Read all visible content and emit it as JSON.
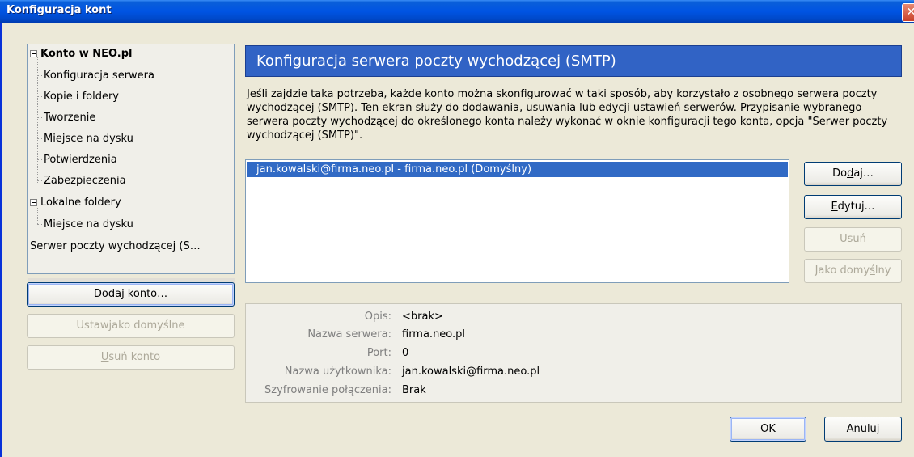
{
  "window": {
    "title": "Konfiguracja kont",
    "close_glyph": "✕"
  },
  "tree": {
    "items": [
      {
        "label": "Konto w NEO.pl",
        "bold": true
      },
      {
        "label": "Konfiguracja serwera"
      },
      {
        "label": "Kopie i foldery"
      },
      {
        "label": "Tworzenie"
      },
      {
        "label": "Miejsce na dysku"
      },
      {
        "label": "Potwierdzenia"
      },
      {
        "label": "Zabezpieczenia"
      },
      {
        "label": "Lokalne foldery"
      },
      {
        "label": "Miejsce na dysku"
      },
      {
        "label": "Serwer poczty wychodzącej (S…"
      }
    ]
  },
  "left_buttons": {
    "add_account": {
      "pre": "",
      "key": "D",
      "post": "odaj konto…"
    },
    "set_default": {
      "pre": "Ustaw ",
      "key": "j",
      "post": "ako domyślne"
    },
    "remove_account": {
      "pre": "",
      "key": "U",
      "post": "suń konto"
    }
  },
  "header": {
    "title": "Konfiguracja serwera poczty wychodzącej (SMTP)"
  },
  "description": "Jeśli zajdzie taka potrzeba, każde konto można skonfigurować w taki sposób, aby korzystało z osobnego serwera poczty wychodzącej (SMTP). Ten ekran służy do dodawania, usuwania lub edycji ustawień serwerów. Przypisanie wybranego serwera poczty wychodzącej do określonego konta należy wykonać w oknie konfiguracji tego konta, opcja \"Serwer poczty wychodzącej (SMTP)\".",
  "server_list": {
    "items": [
      "jan.kowalski@firma.neo.pl - firma.neo.pl (Domyślny)"
    ]
  },
  "right_buttons": {
    "add": {
      "pre": "Do",
      "key": "d",
      "post": "aj…"
    },
    "edit": {
      "pre": "",
      "key": "E",
      "post": "dytuj…"
    },
    "remove": {
      "pre": "",
      "key": "U",
      "post": "suń"
    },
    "set_default": {
      "pre": "Jako domy",
      "key": "ś",
      "post": "lny"
    }
  },
  "details": {
    "rows": [
      {
        "label": "Opis:",
        "value": "<brak>"
      },
      {
        "label": "Nazwa serwera:",
        "value": "firma.neo.pl"
      },
      {
        "label": "Port:",
        "value": "0"
      },
      {
        "label": "Nazwa użytkownika:",
        "value": "jan.kowalski@firma.neo.pl"
      },
      {
        "label": "Szyfrowanie połączenia:",
        "value": "Brak"
      }
    ]
  },
  "footer": {
    "ok": "OK",
    "cancel": "Anuluj"
  }
}
